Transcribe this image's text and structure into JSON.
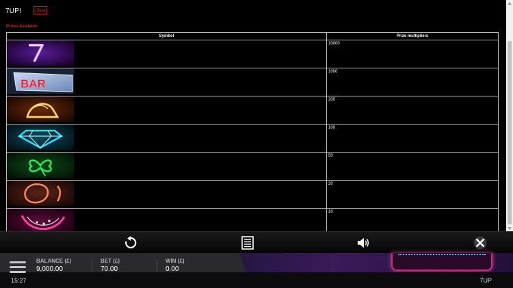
{
  "window": {
    "title": "7UP!",
    "close_label": "Close"
  },
  "prizes": {
    "heading": "Prizes Available",
    "headers": {
      "symbol": "Symbol",
      "multipliers": "Prize multipliers"
    },
    "rows": [
      {
        "symbol": "seven-symbol-icon",
        "multiplier": "10000",
        "color": "#9b2cff"
      },
      {
        "symbol": "bar-symbol-icon",
        "multiplier": "1000",
        "color": "#ff2a4a"
      },
      {
        "symbol": "bell-symbol-icon",
        "multiplier": "200",
        "color": "#ffb021"
      },
      {
        "symbol": "diamond-symbol-icon",
        "multiplier": "100",
        "color": "#36d7ff"
      },
      {
        "symbol": "clover-symbol-icon",
        "multiplier": "50",
        "color": "#2ee85c"
      },
      {
        "symbol": "plum-symbol-icon",
        "multiplier": "20",
        "color": "#ff8a5c"
      },
      {
        "symbol": "watermelon-symbol-icon",
        "multiplier": "10",
        "color": "#ff3fa0"
      }
    ]
  },
  "toolbar": {
    "icons": [
      "replay-icon",
      "paytable-icon",
      "sound-icon",
      "close-icon"
    ]
  },
  "hud": {
    "balance_label": "BALANCE (£)",
    "balance_value": "9,000.00",
    "bet_label": "BET (£)",
    "bet_value": "70.00",
    "win_label": "WIN (£)",
    "win_value": "0.00",
    "clock": "15:27",
    "game_name": "7UP"
  }
}
